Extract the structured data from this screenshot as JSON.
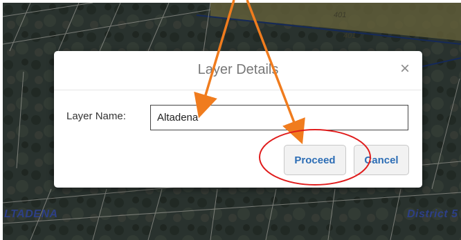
{
  "map": {
    "labels": {
      "left": "LTADENA",
      "right": "District 5"
    },
    "road_numbers": [
      "401",
      "401"
    ]
  },
  "dialog": {
    "title": "Layer Details",
    "close_symbol": "×",
    "field_label": "Layer Name:",
    "field_value": "Altadena",
    "proceed_label": "Proceed",
    "cancel_label": "Cancel"
  },
  "annotation": {
    "arrow_color": "#f07c1e",
    "circle_color": "#e01c1c"
  },
  "colors": {
    "button_text": "#2c6db5",
    "map_label": "#2d3f86"
  }
}
